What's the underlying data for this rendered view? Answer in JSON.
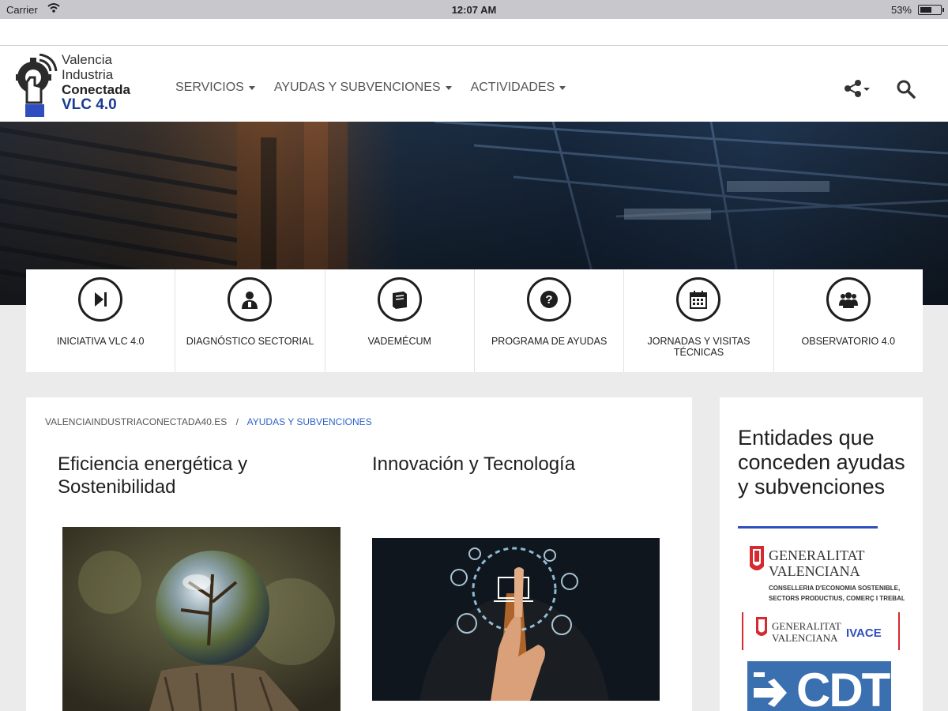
{
  "status_bar": {
    "carrier": "Carrier",
    "time": "12:07 AM",
    "battery": "53%"
  },
  "logo": {
    "line1": "Valencia",
    "line2": "Industria",
    "line3": "Conectada",
    "line4": "VLC 4.0"
  },
  "nav": [
    {
      "label": "SERVICIOS"
    },
    {
      "label": "AYUDAS Y SUBVENCIONES"
    },
    {
      "label": "ACTIVIDADES"
    }
  ],
  "icon_strip": [
    {
      "label": "INICIATIVA VLC 4.0",
      "icon": "play-skip-icon"
    },
    {
      "label": "DIAGNÓSTICO SECTORIAL",
      "icon": "doctor-icon"
    },
    {
      "label": "VADEMÉCUM",
      "icon": "book-icon"
    },
    {
      "label": "PROGRAMA DE AYUDAS",
      "icon": "question-icon"
    },
    {
      "label": "JORNADAS Y VISITAS TÉCNICAS",
      "icon": "calendar-icon"
    },
    {
      "label": "OBSERVATORIO 4.0",
      "icon": "group-icon"
    }
  ],
  "breadcrumb": {
    "home": "VALENCIAINDUSTRIACONECTADA40.ES",
    "separator": "/",
    "current": "AYUDAS Y SUBVENCIONES"
  },
  "cards": [
    {
      "title": "Eficiencia energética y Sostenibilidad"
    },
    {
      "title": "Innovación y Tecnología"
    }
  ],
  "sidebar": {
    "title": "Entidades que conceden ayudas y subvenciones",
    "gv1": {
      "name_line1": "GENERALITAT",
      "name_line2": "VALENCIANA",
      "dept_line1": "CONSELLERIA D'ECONOMIA SOSTENIBLE,",
      "dept_line2": "SECTORS PRODUCTIUS, COMERÇ I TREBALL"
    },
    "gv2": {
      "name_line1": "GENERALITAT",
      "name_line2": "VALENCIANA",
      "ivace": "IVACE"
    },
    "cdti": "CDTI"
  },
  "colors": {
    "accent": "#2f63c9",
    "rule": "#2f4fc0",
    "logo_blue": "#1a3a8f"
  }
}
